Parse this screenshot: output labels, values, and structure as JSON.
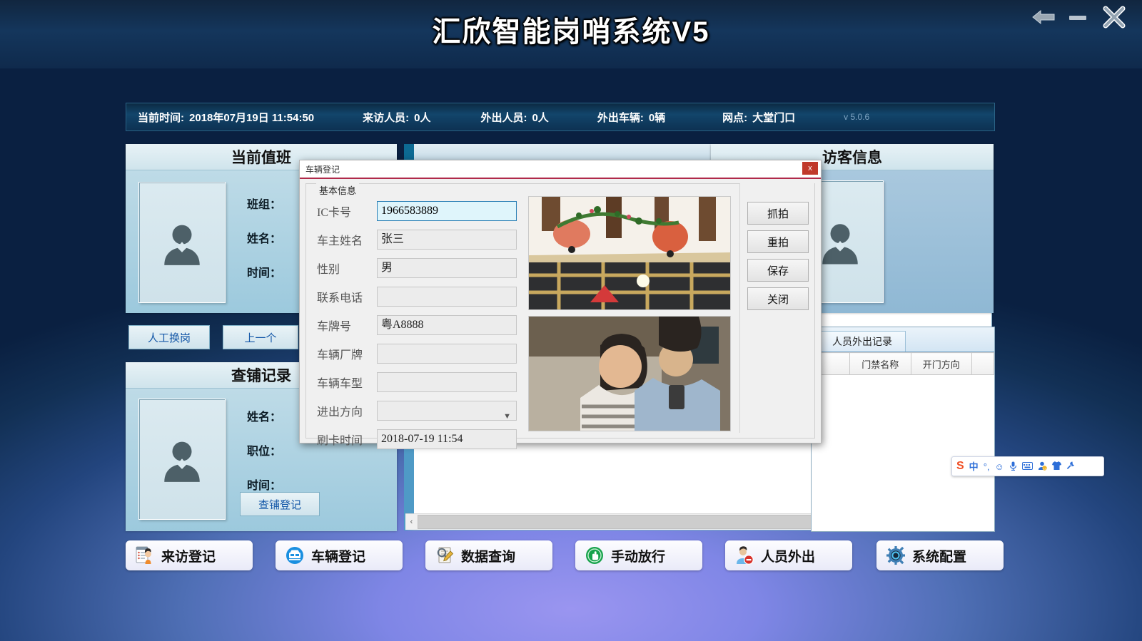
{
  "app": {
    "title": "汇欣智能岗哨系统V5",
    "window_controls": [
      {
        "name": "back",
        "glyph": "←"
      },
      {
        "name": "minimize",
        "glyph": "–"
      },
      {
        "name": "close",
        "glyph": "✕"
      }
    ]
  },
  "statusbar": {
    "time_label": "当前时间:",
    "time_value": "2018年07月19日 11:54:50",
    "visitors_label": "来访人员:",
    "visitors_value": "0人",
    "out_people_label": "外出人员:",
    "out_people_value": "0人",
    "out_cars_label": "外出车辆:",
    "out_cars_value": "0辆",
    "site_label": "网点:",
    "site_value": "大堂门口",
    "version": "v 5.0.6"
  },
  "duty_panel": {
    "title": "当前值班",
    "fields": [
      "班组：",
      "姓名：",
      "时间："
    ],
    "manual_shift_button": "人工换岗",
    "prev_button": "上一个"
  },
  "bed_panel": {
    "title": "查铺记录",
    "fields": [
      "姓名：",
      "职位：",
      "时间："
    ],
    "register_button": "查铺登记"
  },
  "visitor_panel": {
    "title": "访客信息"
  },
  "records_panel": {
    "tab": "人员外出记录",
    "columns": [
      "",
      "门禁名称",
      "开门方向",
      ""
    ],
    "rows": []
  },
  "dialog": {
    "title": "车辆登记",
    "close_glyph": "x",
    "group_legend": "基本信息",
    "fields": [
      {
        "label": "IC卡号",
        "value": "1966583889",
        "type": "text",
        "focused": true
      },
      {
        "label": "车主姓名",
        "value": "张三",
        "type": "text",
        "focused": false
      },
      {
        "label": "性别",
        "value": "男",
        "type": "text",
        "focused": false
      },
      {
        "label": "联系电话",
        "value": "",
        "type": "text",
        "focused": false
      },
      {
        "label": "车牌号",
        "value": "粤A8888",
        "type": "text",
        "focused": false
      },
      {
        "label": "车辆厂牌",
        "value": "",
        "type": "text",
        "focused": false
      },
      {
        "label": "车辆车型",
        "value": "",
        "type": "text",
        "focused": false
      },
      {
        "label": "进出方向",
        "value": "",
        "type": "select",
        "focused": false
      },
      {
        "label": "刷卡时间",
        "value": "2018-07-19  11:54",
        "type": "text",
        "focused": false
      }
    ],
    "buttons": [
      "抓拍",
      "重拍",
      "保存",
      "关闭"
    ]
  },
  "toolbar": {
    "buttons": [
      {
        "label": "来访登记",
        "icon": "visitor-register-icon",
        "color": "#f07c25"
      },
      {
        "label": "车辆登记",
        "icon": "vehicle-register-icon",
        "color": "#1a8fe0"
      },
      {
        "label": "数据查询",
        "icon": "data-query-icon",
        "color": "#8a7a55"
      },
      {
        "label": "手动放行",
        "icon": "manual-pass-icon",
        "color": "#18a14a"
      },
      {
        "label": "人员外出",
        "icon": "person-out-icon",
        "color": "#4ea2e0"
      },
      {
        "label": "系统配置",
        "icon": "system-config-icon",
        "color": "#2b6fa8"
      }
    ]
  },
  "ime": {
    "name": "sogou-ime",
    "items": [
      {
        "name": "sogou-logo-icon",
        "glyph": "S"
      },
      {
        "name": "chinese-mode-icon",
        "glyph": "中"
      },
      {
        "name": "punctuation-icon",
        "glyph": "°,"
      },
      {
        "name": "emoji-icon",
        "glyph": "☺"
      },
      {
        "name": "voice-input-icon",
        "glyph": "🎤"
      },
      {
        "name": "soft-keyboard-icon",
        "glyph": "⌨"
      },
      {
        "name": "user-center-icon",
        "glyph": "👤"
      },
      {
        "name": "skin-icon",
        "glyph": "👕"
      },
      {
        "name": "toolbox-icon",
        "glyph": "🔧"
      }
    ]
  },
  "scrollbar": {
    "left_glyph": "‹",
    "right_glyph": "›"
  }
}
